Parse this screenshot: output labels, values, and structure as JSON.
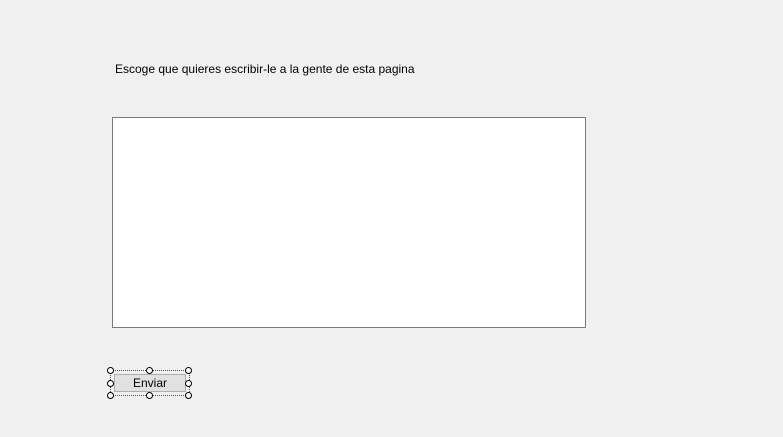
{
  "form": {
    "prompt_label": "Escoge que quieres escribir-le a la gente de esta pagina",
    "message_value": "",
    "send_button_label": "Enviar"
  }
}
